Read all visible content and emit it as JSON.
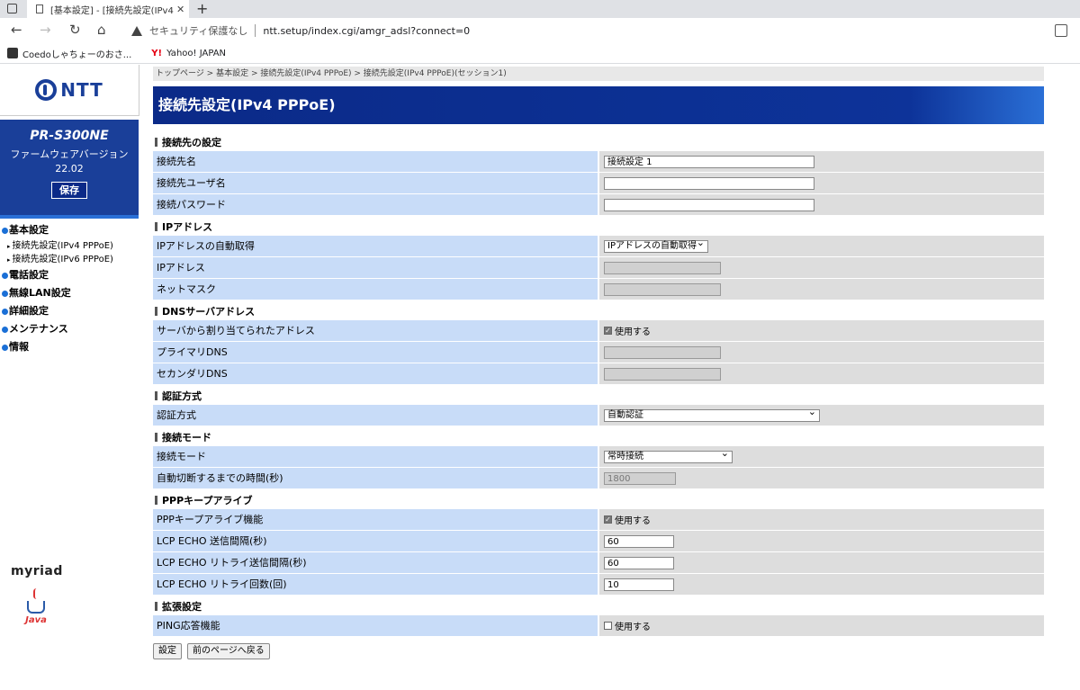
{
  "browser": {
    "tab_title": "[基本設定] - [接続先設定(IPv4 PP",
    "security_label": "セキュリティ保護なし",
    "url": "ntt.setup/index.cgi/amgr_adsl?connect=0",
    "bookmarks": [
      "Coedoしゃちょーのおさ...",
      "Yahoo! JAPAN"
    ]
  },
  "sidebar": {
    "logo": "NTT",
    "model": "PR-S300NE",
    "firmware_label": "ファームウェアバージョン",
    "firmware_version": "22.02",
    "save_label": "保存",
    "nav": {
      "basic": "基本設定",
      "sub1": "接続先設定(IPv4 PPPoE)",
      "sub2": "接続先設定(IPv6 PPPoE)",
      "phone": "電話設定",
      "wlan": "無線LAN設定",
      "advanced": "詳細設定",
      "maintenance": "メンテナンス",
      "info": "情報"
    },
    "myriad": "myriad",
    "java": "Java"
  },
  "main": {
    "breadcrumb": "トップページ > 基本設定 > 接続先設定(IPv4 PPPoE) > 接続先設定(IPv4 PPPoE)(セッション1)",
    "title": "接続先設定(IPv4 PPPoE)",
    "sections": {
      "conn": {
        "title": "接続先の設定",
        "name_label": "接続先名",
        "name_value": "接続設定 1",
        "user_label": "接続先ユーザ名",
        "user_value": "",
        "pass_label": "接続パスワード",
        "pass_value": ""
      },
      "ip": {
        "title": "IPアドレス",
        "auto_label": "IPアドレスの自動取得",
        "auto_value": "IPアドレスの自動取得",
        "addr_label": "IPアドレス",
        "mask_label": "ネットマスク"
      },
      "dns": {
        "title": "DNSサーバアドレス",
        "assigned_label": "サーバから割り当てられたアドレス",
        "assigned_check": "使用する",
        "primary_label": "プライマリDNS",
        "secondary_label": "セカンダリDNS"
      },
      "auth": {
        "title": "認証方式",
        "method_label": "認証方式",
        "method_value": "自動認証"
      },
      "mode": {
        "title": "接続モード",
        "mode_label": "接続モード",
        "mode_value": "常時接続",
        "timeout_label": "自動切断するまでの時間(秒)",
        "timeout_value": "1800"
      },
      "keepalive": {
        "title": "PPPキープアライブ",
        "func_label": "PPPキープアライブ機能",
        "func_check": "使用する",
        "interval_label": "LCP ECHO 送信間隔(秒)",
        "interval_value": "60",
        "retry_interval_label": "LCP ECHO リトライ送信間隔(秒)",
        "retry_interval_value": "60",
        "retry_count_label": "LCP ECHO リトライ回数(回)",
        "retry_count_value": "10"
      },
      "ext": {
        "title": "拡張設定",
        "ping_label": "PING応答機能",
        "ping_check": "使用する"
      }
    },
    "buttons": {
      "submit": "設定",
      "back": "前のページへ戻る"
    }
  }
}
